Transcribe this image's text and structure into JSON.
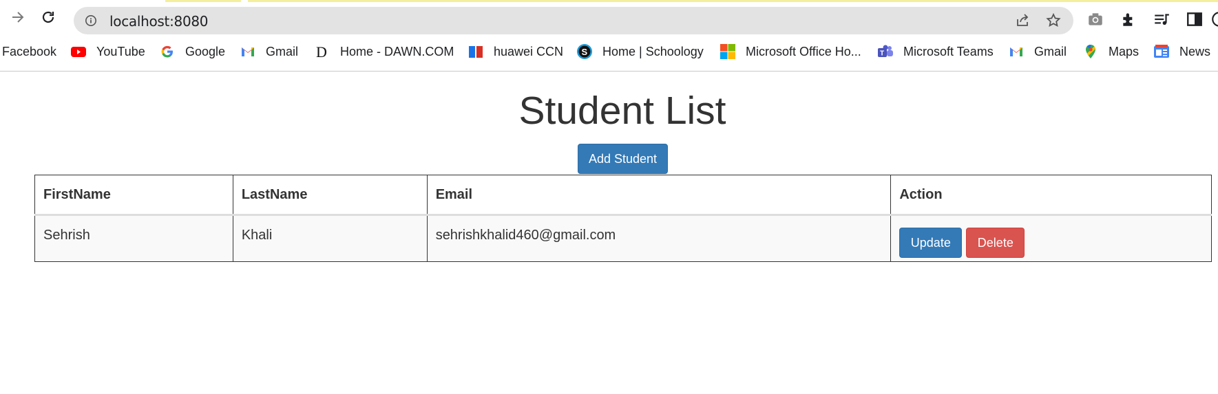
{
  "browser": {
    "url": "localhost:8080",
    "bookmarks": [
      {
        "label": "Facebook",
        "icon": "facebook-icon"
      },
      {
        "label": "YouTube",
        "icon": "youtube-icon"
      },
      {
        "label": "Google",
        "icon": "google-icon"
      },
      {
        "label": "Gmail",
        "icon": "gmail-icon"
      },
      {
        "label": "Home - DAWN.COM",
        "icon": "dawn-icon"
      },
      {
        "label": "huawei CCN",
        "icon": "huawei-icon"
      },
      {
        "label": "Home | Schoology",
        "icon": "schoology-icon"
      },
      {
        "label": "Microsoft Office Ho...",
        "icon": "microsoft-office-icon"
      },
      {
        "label": "Microsoft Teams",
        "icon": "teams-icon"
      },
      {
        "label": "Gmail",
        "icon": "gmail-icon"
      },
      {
        "label": "Maps",
        "icon": "maps-icon"
      },
      {
        "label": "News",
        "icon": "news-icon"
      }
    ]
  },
  "page": {
    "title": "Student List",
    "add_button": "Add Student",
    "columns": [
      "FirstName",
      "LastName",
      "Email",
      "Action"
    ],
    "rows": [
      {
        "first": "Sehrish",
        "last": "Khali",
        "email": "sehrishkhalid460@gmail.com",
        "update": "Update",
        "delete": "Delete"
      }
    ]
  },
  "colors": {
    "primary": "#337ab7",
    "danger": "#d9534f",
    "text": "#333333"
  }
}
